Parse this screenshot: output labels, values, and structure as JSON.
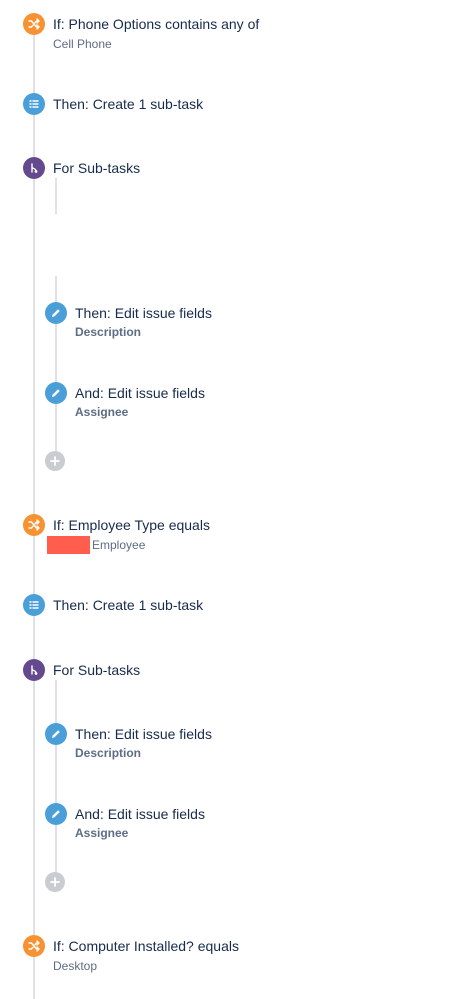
{
  "rules": [
    {
      "icon": "shuffle-icon",
      "title": "If: Phone Options contains any of",
      "value": "Cell Phone"
    },
    {
      "icon": "list-icon",
      "title": "Then: Create 1 sub-task"
    },
    {
      "icon": "branch-icon",
      "title": "For Sub-tasks",
      "children": [
        {
          "icon": "pencil-icon",
          "title": "Then: Edit issue fields",
          "value": "Description"
        },
        {
          "icon": "pencil-icon",
          "title": "And: Edit issue fields",
          "value": "Assignee"
        }
      ]
    },
    {
      "icon": "shuffle-icon",
      "title": "If: Employee Type equals",
      "value": "Employee"
    },
    {
      "icon": "list-icon",
      "title": "Then: Create 1 sub-task"
    },
    {
      "icon": "branch-icon",
      "title": "For Sub-tasks",
      "children": [
        {
          "icon": "pencil-icon",
          "title": "Then: Edit issue fields",
          "value": "Description"
        },
        {
          "icon": "pencil-icon",
          "title": "And: Edit issue fields",
          "value": "Assignee"
        }
      ]
    },
    {
      "icon": "shuffle-icon",
      "title": "If: Computer Installed? equals",
      "value": "Desktop"
    }
  ],
  "colors": {
    "condition": "#f79232",
    "action": "#4a9fd9",
    "branch": "#65498f",
    "add": "#c9ccd1",
    "redaction": "#ff5e4f"
  }
}
